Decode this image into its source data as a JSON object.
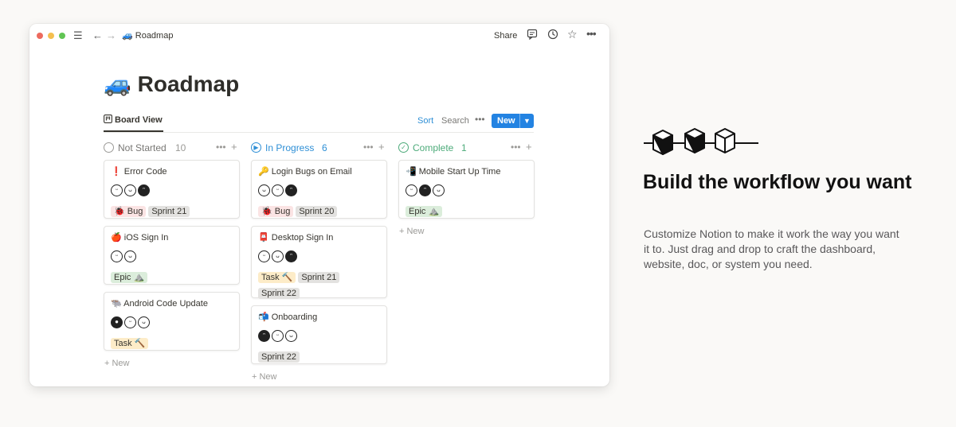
{
  "window": {
    "breadcrumb": "🚙 Roadmap",
    "share_label": "Share",
    "page_title": "🚙 Roadmap"
  },
  "toolbar": {
    "tab_label": "Board View",
    "sort_label": "Sort",
    "search_label": "Search",
    "new_label": "New"
  },
  "columns": [
    {
      "name": "Not Started",
      "count": "10",
      "color": "#9b9a97",
      "cards": [
        {
          "title": "❗ Error Code",
          "tags": [
            "🐞 Bug",
            "Sprint 21"
          ]
        },
        {
          "title": "🍎 iOS Sign In",
          "tags": [
            "Epic ⛰️"
          ]
        },
        {
          "title": "🐃 Android Code Update",
          "tags": [
            "Task 🔨"
          ]
        }
      ],
      "new_label": "+ New"
    },
    {
      "name": "In Progress",
      "count": "6",
      "color": "#2e8fd6",
      "cards": [
        {
          "title": "🔑 Login Bugs on Email",
          "tags": [
            "🐞 Bug",
            "Sprint 20"
          ]
        },
        {
          "title": "📮 Desktop Sign In",
          "tags": [
            "Task 🔨",
            "Sprint 21",
            "Sprint 22"
          ]
        },
        {
          "title": "📬 Onboarding",
          "tags": [
            "Sprint 22"
          ]
        }
      ],
      "new_label": "+ New"
    },
    {
      "name": "Complete",
      "count": "1",
      "color": "#4dab7a",
      "cards": [
        {
          "title": "📲 Mobile Start Up Time",
          "tags": [
            "Epic ⛰️"
          ]
        }
      ],
      "new_label": "+ New"
    }
  ],
  "hero": {
    "title": "Build the workflow you want",
    "description": "Customize Notion to make it work the way you want it to. Just drag and drop to craft the dashboard, website, doc, or system you need."
  },
  "colors": {
    "accent": "#2383e2",
    "bug_tag": "#fbe4e4",
    "sprint_tag": "#e3e2e0",
    "epic_tag": "#dbeddb",
    "task_tag": "#fdecc8"
  },
  "icons": [
    "close-dot",
    "minimize-dot",
    "zoom-dot",
    "menu-icon",
    "back-arrow-icon",
    "forward-arrow-icon",
    "comment-icon",
    "clock-icon",
    "star-icon",
    "more-icon",
    "board-icon",
    "cube-chain-icon"
  ]
}
